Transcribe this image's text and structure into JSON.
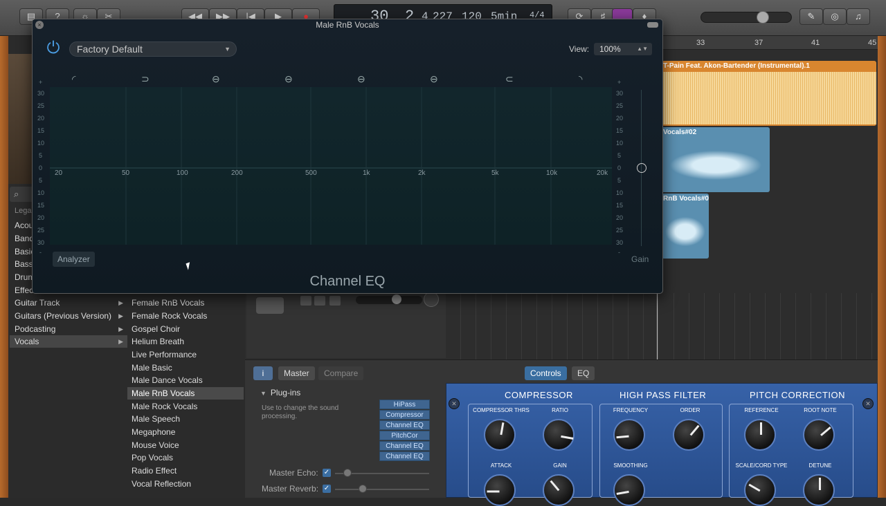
{
  "toolbar": {
    "lcd_bar": "30",
    "lcd_beat": "2",
    "lcd_div": "4",
    "lcd_tick": "227",
    "lcd_tempo": "120",
    "lcd_key": "5min",
    "lcd_sig": "4/4"
  },
  "library": {
    "categories": [
      {
        "label": "Legacy"
      },
      {
        "label": "Acoustic"
      },
      {
        "label": "Band"
      },
      {
        "label": "Basic"
      },
      {
        "label": "Bass"
      },
      {
        "label": "Drums"
      },
      {
        "label": "Effects"
      },
      {
        "label": "Guitar Track"
      },
      {
        "label": "Guitars (Previous Version)"
      },
      {
        "label": "Podcasting"
      },
      {
        "label": "Vocals"
      }
    ],
    "presets": [
      "Female RnB Vocals",
      "Female Rock Vocals",
      "Gospel Choir",
      "Helium Breath",
      "Live Performance",
      "Male Basic",
      "Male Dance Vocals",
      "Male RnB Vocals",
      "Male Rock Vocals",
      "Male Speech",
      "Megaphone",
      "Mouse Voice",
      "Pop Vocals",
      "Radio Effect",
      "Vocal Reflection"
    ],
    "selected_preset": "Male RnB Vocals"
  },
  "ruler": [
    "33",
    "37",
    "41",
    "45"
  ],
  "regions": {
    "orange": "T-Pain Feat. Akon-Bartender (Instrumental).1",
    "blue1": "Vocals#02",
    "blue2": "RnB Vocals#0"
  },
  "eq_window": {
    "title": "Male RnB Vocals",
    "preset": "Factory Default",
    "view_label": "View:",
    "view_value": "100%",
    "freq_labels": [
      "20",
      "50",
      "100",
      "200",
      "500",
      "1k",
      "2k",
      "5k",
      "10k",
      "20k"
    ],
    "db_labels": [
      "+",
      "30",
      "25",
      "20",
      "15",
      "10",
      "5",
      "0",
      "5",
      "10",
      "15",
      "20",
      "25",
      "30",
      "-"
    ],
    "analyzer": "Analyzer",
    "gain": "Gain",
    "plugin_name": "Channel EQ"
  },
  "smart_controls": {
    "master": "Master",
    "compare": "Compare",
    "controls": "Controls",
    "eq": "EQ",
    "plugins_title": "Plug-ins",
    "plugins_desc": "Use to change the sound processing.",
    "plugins": [
      "HiPass",
      "Compressor",
      "Channel EQ",
      "PitchCor",
      "Channel EQ",
      "Channel EQ"
    ],
    "master_echo": "Master Echo:",
    "master_reverb": "Master Reverb:",
    "sections": {
      "compressor": "COMPRESSOR",
      "hpf": "HIGH PASS FILTER",
      "pitch": "PITCH CORRECTION"
    },
    "knobs": {
      "comp_thrs": "COMPRESSOR THRS",
      "ratio": "RATIO",
      "attack": "ATTACK",
      "gain": "GAIN",
      "frequency": "FREQUENCY",
      "order": "ORDER",
      "smoothing": "SMOOTHING",
      "reference": "REFERENCE",
      "root_note": "ROOT NOTE",
      "scale_type": "SCALE/CORD TYPE",
      "detune": "DETUNE"
    }
  }
}
